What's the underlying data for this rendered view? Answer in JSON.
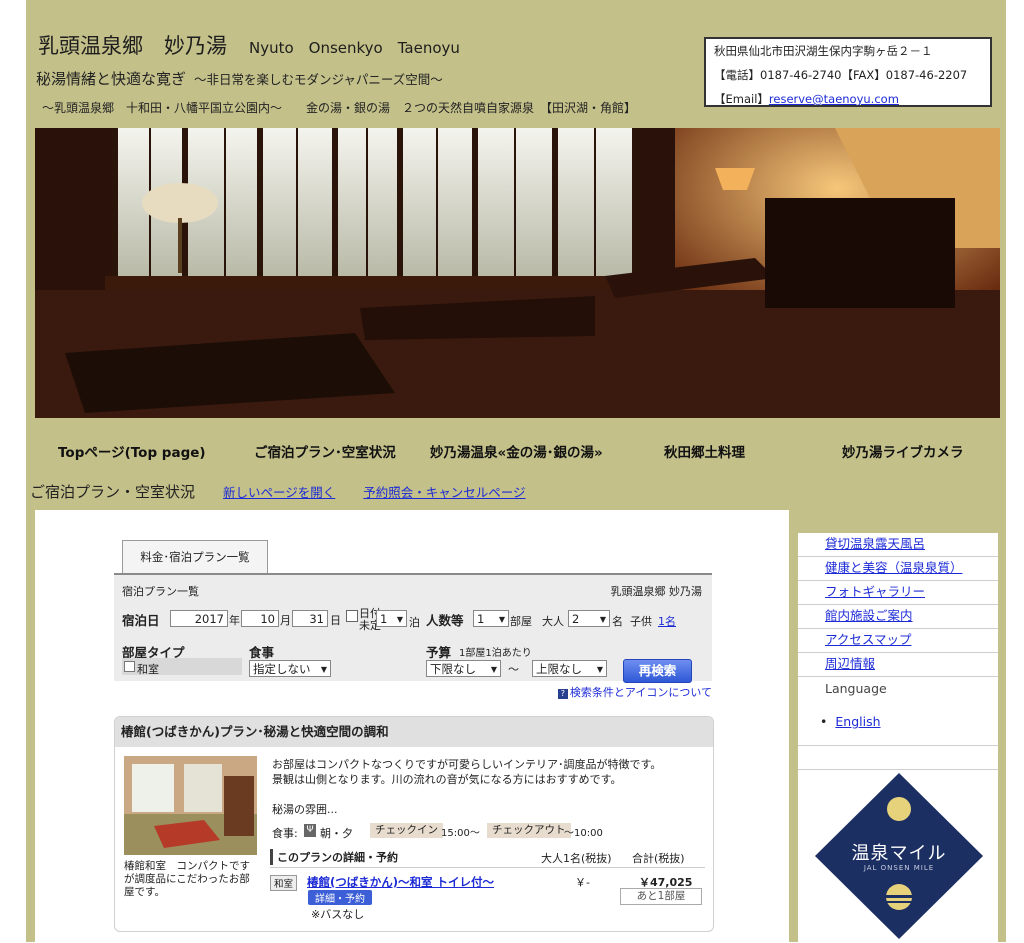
{
  "header": {
    "title_ja": "乳頭温泉郷　妙乃湯",
    "title_en": "Nyuto　Onsenkyo　Taenoyu",
    "subtitle": "秘湯情緒と快適な寛ぎ",
    "subtitle2": "～非日常を楽しむモダンジャパニーズ空間～",
    "line3": "～乳頭温泉郷　十和田・八幡平国立公園内～　　金の湯・銀の湯　２つの天然自噴自家源泉　【田沢湖・角館】"
  },
  "contact": {
    "address": "秋田県仙北市田沢湖生保内字駒ヶ岳２－１",
    "phone": "【電話】0187-46-2740【FAX】0187-46-2207",
    "email_label": "【Email】",
    "email": "reserve@taenoyu.com"
  },
  "nav": {
    "items": [
      "Topページ(Top page)",
      "ご宿泊プラン･空室状況",
      "妙乃湯温泉«金の湯･銀の湯»",
      "秋田郷土料理",
      "妙乃湯ライブカメラ"
    ]
  },
  "crumb": {
    "title": "ご宿泊プラン・空室状況",
    "link1": "新しいページを開く",
    "link2": "予約照会・キャンセルページ"
  },
  "search": {
    "tab": "料金･宿泊プラン一覧",
    "caption": "宿泊プラン一覧",
    "inn": "乳頭温泉郷 妙乃湯",
    "date_label": "宿泊日",
    "year": "2017",
    "year_unit": "年",
    "month": "10",
    "month_unit": "月",
    "day": "31",
    "day_unit": "日",
    "undecided_1": "日付",
    "undecided_2": "未定",
    "nights": "1",
    "nights_unit": "泊",
    "people_label": "人数等",
    "rooms": "1",
    "rooms_unit": "部屋",
    "adult_label": "大人",
    "adults": "2",
    "adults_unit": "名",
    "child_label": "子供",
    "child_link": "1名",
    "roomtype_label": "部屋タイプ",
    "roomtype_option": "和室",
    "meal_label": "食事",
    "meal_value": "指定しない",
    "budget_label": "予算",
    "budget_note": "1部屋1泊あたり",
    "budget_min": "下限なし",
    "budget_tilde": "～",
    "budget_max": "上限なし",
    "button": "再検索",
    "help": "検索条件とアイコンについて"
  },
  "plan": {
    "title": "椿館(つばきかん)プラン･秘湯と快適空間の調和",
    "desc1": "お部屋はコンパクトなつくりですが可愛らしいインテリア･調度品が特徴です。",
    "desc2": "景観は山側となります。川の流れの音が気になる方にはおすすめです。",
    "desc3": "秘湯の雰囲...",
    "meal_label": "食事:",
    "meal_value": "朝・夕",
    "checkin_label": "チェックイン",
    "checkin": "15:00～",
    "checkout_label": "チェックアウト",
    "checkout": "～10:00",
    "caption1": "椿館和室　コンパクトです",
    "caption2": "が調度品にこだわったお部",
    "caption3": "屋です。",
    "detail_label": "このプランの詳細・予約",
    "col_adult": "大人1名(税抜)",
    "col_total": "合計(税抜)",
    "room_badge": "和室",
    "room_name": "椿館(つばきかん)～和室 トイレ付～",
    "price_adult": "￥-",
    "price_total": "￥47,025",
    "detail_btn": "詳細・予約",
    "remaining": "あと1部屋",
    "note": "※バスなし"
  },
  "sidebar": {
    "items": [
      "貸切温泉露天風呂",
      "健康と美容（温泉泉質）",
      "フォトギャラリー",
      "館内施設ご案内",
      "アクセスマップ",
      "周辺情報"
    ],
    "language_label": "Language",
    "language_link": "English",
    "banner_title": "温泉マイル",
    "banner_sub": "JAL ONSEN MILE"
  }
}
